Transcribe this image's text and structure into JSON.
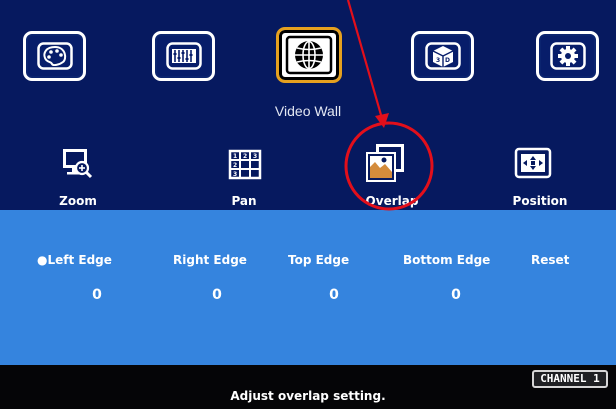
{
  "main_menu": {
    "items": [
      {
        "icon": "palette-icon"
      },
      {
        "icon": "equalizer-icon"
      },
      {
        "icon": "globe-icon",
        "selected": true
      },
      {
        "icon": "cube-3d-icon"
      },
      {
        "icon": "gear-icon"
      }
    ],
    "title": "Video Wall"
  },
  "sub_menu": {
    "items": [
      {
        "label": "Zoom",
        "icon": "zoom-icon"
      },
      {
        "label": "Pan",
        "icon": "grid-pan-icon"
      },
      {
        "label": "Overlap",
        "icon": "overlap-image-icon",
        "selected": true
      },
      {
        "label": "Position",
        "icon": "position-arrows-icon"
      }
    ]
  },
  "overlap_settings": {
    "edges": [
      {
        "label": "●Left Edge",
        "value": "0",
        "active": true
      },
      {
        "label": "Right Edge",
        "value": "0"
      },
      {
        "label": "Top Edge",
        "value": "0"
      },
      {
        "label": "Bottom Edge",
        "value": "0"
      },
      {
        "label": "Reset"
      }
    ]
  },
  "footer": {
    "help_text": "Adjust overlap setting.",
    "channel": "CHANNEL 1"
  },
  "colors": {
    "top_background": "#06195f",
    "panel_background": "#3584de",
    "footer_background": "#050507",
    "selected_border": "#e6a11f",
    "annotation_red": "#e20f1b"
  }
}
